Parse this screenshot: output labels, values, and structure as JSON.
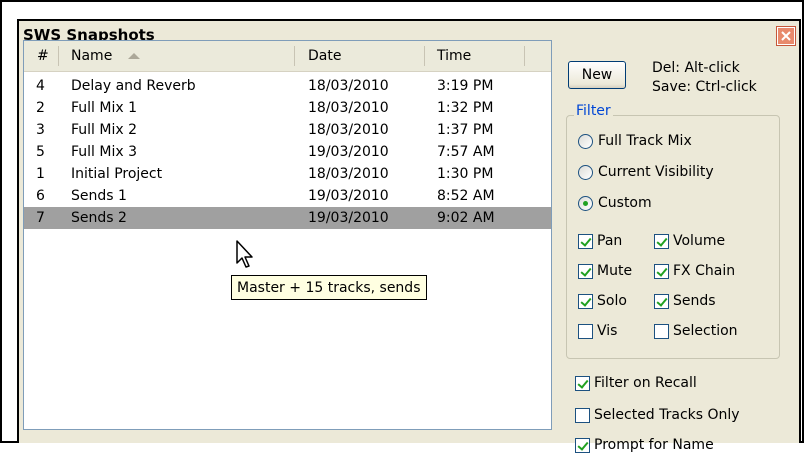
{
  "window": {
    "title": "SWS Snapshots"
  },
  "list": {
    "columns": [
      "#",
      "Name",
      "Date",
      "Time"
    ],
    "rows": [
      {
        "num": "4",
        "name": "Delay and Reverb",
        "date": "18/03/2010",
        "time": "3:19 PM",
        "selected": false
      },
      {
        "num": "2",
        "name": "Full Mix 1",
        "date": "18/03/2010",
        "time": "1:32 PM",
        "selected": false
      },
      {
        "num": "3",
        "name": "Full Mix 2",
        "date": "18/03/2010",
        "time": "1:37 PM",
        "selected": false
      },
      {
        "num": "5",
        "name": "Full Mix 3",
        "date": "19/03/2010",
        "time": "7:57 AM",
        "selected": false
      },
      {
        "num": "1",
        "name": "Initial Project",
        "date": "18/03/2010",
        "time": "1:30 PM",
        "selected": false
      },
      {
        "num": "6",
        "name": "Sends 1",
        "date": "19/03/2010",
        "time": "8:52 AM",
        "selected": false
      },
      {
        "num": "7",
        "name": "Sends 2",
        "date": "19/03/2010",
        "time": "9:02 AM",
        "selected": true
      }
    ],
    "tooltip": "Master + 15 tracks, sends"
  },
  "controls": {
    "new_label": "New",
    "hint_delete": "Del: Alt-click",
    "hint_save": "Save: Ctrl-click"
  },
  "filter": {
    "label": "Filter",
    "radios": [
      {
        "label": "Full Track Mix",
        "selected": false
      },
      {
        "label": "Current Visibility",
        "selected": false
      },
      {
        "label": "Custom",
        "selected": true
      }
    ],
    "checks": {
      "pan": {
        "label": "Pan",
        "checked": true
      },
      "volume": {
        "label": "Volume",
        "checked": true
      },
      "mute": {
        "label": "Mute",
        "checked": true
      },
      "fx_chain": {
        "label": "FX Chain",
        "checked": true
      },
      "solo": {
        "label": "Solo",
        "checked": true
      },
      "sends": {
        "label": "Sends",
        "checked": true
      },
      "vis": {
        "label": "Vis",
        "checked": false
      },
      "selection": {
        "label": "Selection",
        "checked": false
      }
    }
  },
  "options": {
    "filter_on_recall": {
      "label": "Filter on Recall",
      "checked": true
    },
    "selected_tracks_only": {
      "label": "Selected Tracks Only",
      "checked": false
    },
    "partial": {
      "label": "Prompt for Name",
      "checked": true
    }
  },
  "colors": {
    "dialog_bg": "#ece9d8",
    "selected_row": "#a0a0a0",
    "tooltip_bg": "#ffffe1",
    "filter_label": "#0046d5",
    "check_mark": "#21a121"
  },
  "icons": [
    "close-icon",
    "sort-ascending-icon",
    "mouse-pointer-icon"
  ]
}
